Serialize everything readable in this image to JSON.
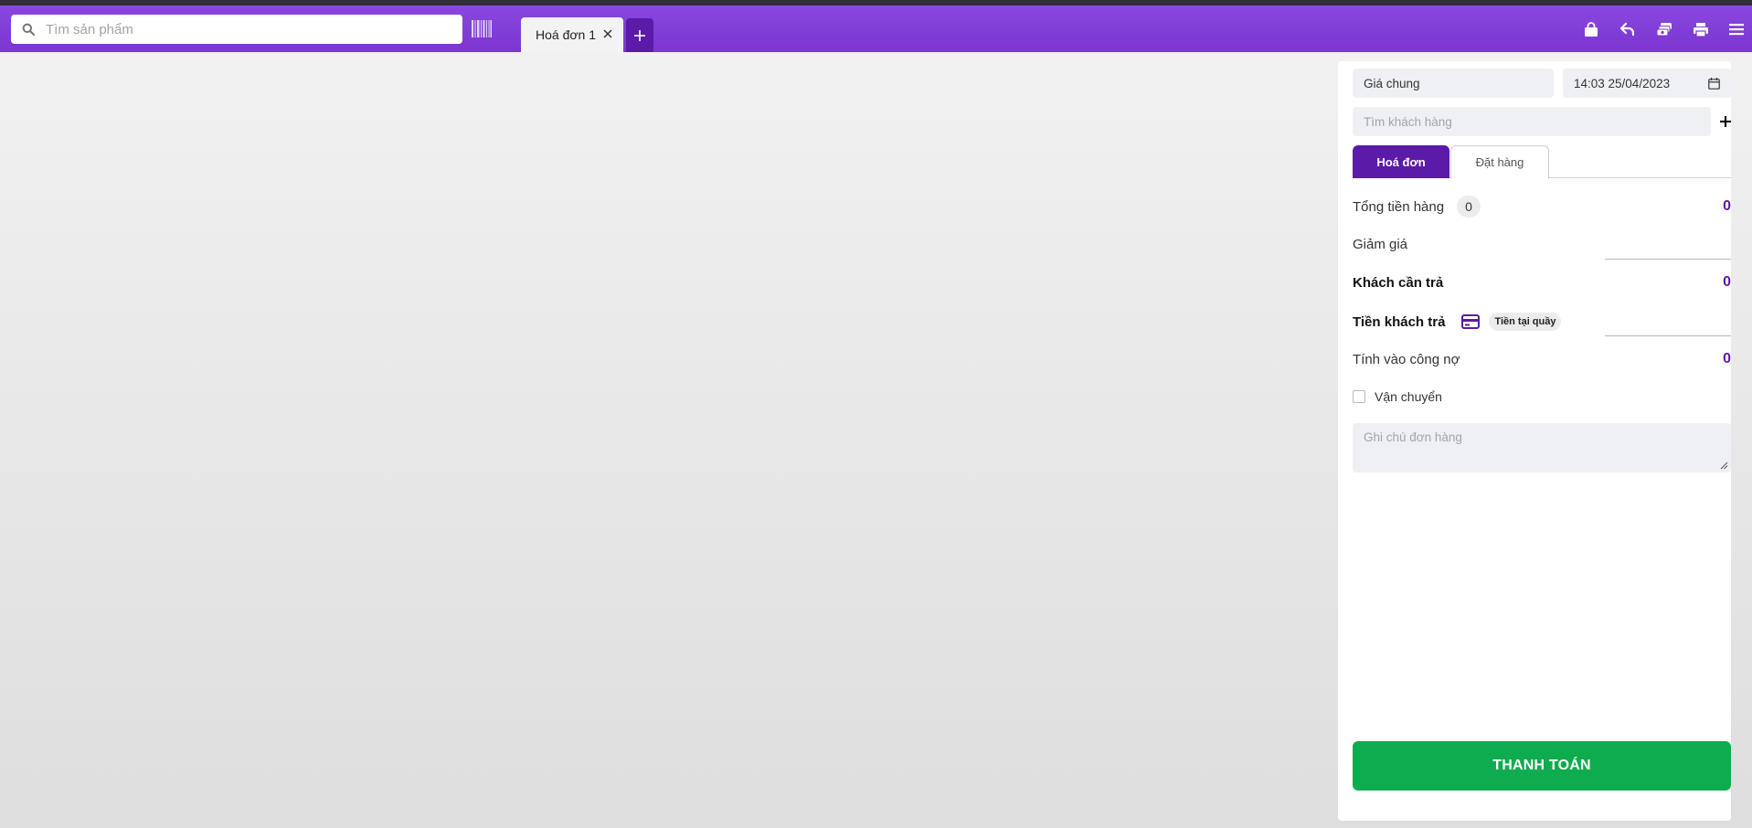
{
  "search": {
    "placeholder": "Tìm sản phẩm"
  },
  "tabs": [
    {
      "label": "Hoá đơn 1"
    }
  ],
  "toolbar_icons": [
    "bag-icon",
    "undo-icon",
    "money-stack-icon",
    "printer-icon",
    "menu-icon"
  ],
  "panel": {
    "price_list": "Giá chung",
    "datetime": "14:03 25/04/2023",
    "customer_search_placeholder": "Tìm khách hàng",
    "mode_tabs": {
      "invoice": "Hoá đơn",
      "order": "Đặt hàng"
    },
    "total_label": "Tổng tiền hàng",
    "total_count": "0",
    "total_value": "0",
    "discount_label": "Giảm giá",
    "customer_due_label": "Khách cần trả",
    "customer_due_value": "0",
    "customer_paid_label": "Tiền khách trả",
    "payment_method": "Tiền tại quầy",
    "debt_label": "Tính vào công nợ",
    "debt_value": "0",
    "shipping_label": "Vận chuyển",
    "note_placeholder": "Ghi chú đơn hàng",
    "pay_button": "THANH TOÁN"
  },
  "colors": {
    "header": "#7b35d3",
    "accent": "#5b1aa8",
    "pay": "#0eac4e"
  }
}
